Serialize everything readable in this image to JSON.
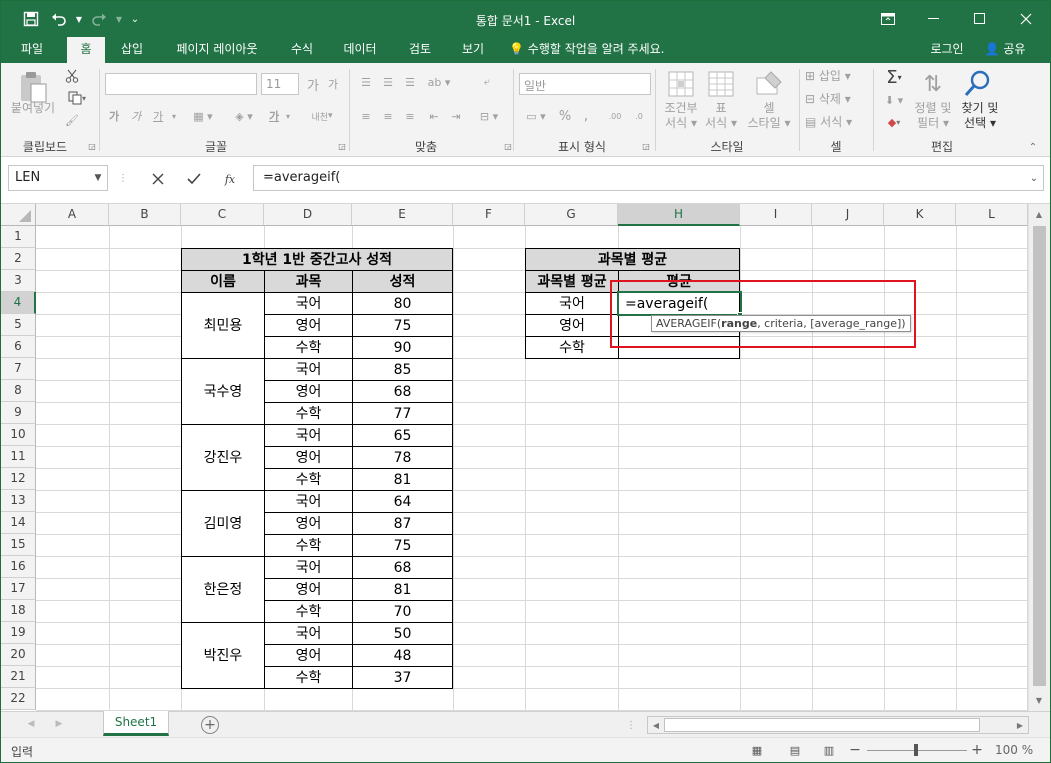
{
  "app": {
    "title": "통합 문서1 - Excel",
    "accent": "#217346"
  },
  "tabs": [
    "파일",
    "홈",
    "삽입",
    "페이지 레이아웃",
    "수식",
    "데이터",
    "검토",
    "보기"
  ],
  "active_tab": "홈",
  "tell_me": "수행할 작업을 알려 주세요.",
  "account": {
    "login": "로그인",
    "share": "공유"
  },
  "ribbon": {
    "clipboard": {
      "paste": "붙여넣기",
      "label": "클립보드"
    },
    "font": {
      "size": "11",
      "label": "글꼴",
      "bold": "가",
      "italic": "가",
      "underline": "가",
      "fontcolor": "가",
      "phonetic": "내천"
    },
    "alignment": {
      "label": "맞춤"
    },
    "number": {
      "format": "일반",
      "label": "표시 형식",
      "percent": "%"
    },
    "styles": {
      "cond_line1": "조건부",
      "cond_line2": "서식",
      "table_line1": "표",
      "table_line2": "서식",
      "cell_line1": "셀",
      "cell_line2": "스타일",
      "label": "스타일"
    },
    "cells": {
      "insert": "삽입",
      "delete": "삭제",
      "format": "서식",
      "label": "셀"
    },
    "editing": {
      "sort_line1": "정렬 및",
      "sort_line2": "필터",
      "find_line1": "찾기 및",
      "find_line2": "선택",
      "label": "편집"
    }
  },
  "formula_bar": {
    "name_box": "LEN",
    "fx": "fx",
    "formula": "=averageif("
  },
  "columns": [
    "A",
    "B",
    "C",
    "D",
    "E",
    "F",
    "G",
    "H",
    "I",
    "J",
    "K",
    "L"
  ],
  "rows": [
    "1",
    "2",
    "3",
    "4",
    "5",
    "6",
    "7",
    "8",
    "9",
    "10",
    "11",
    "12",
    "13",
    "14",
    "15",
    "16",
    "17",
    "18",
    "19",
    "20",
    "21",
    "22"
  ],
  "score_table": {
    "title": "1학년 1반 중간고사 성적",
    "headers": [
      "이름",
      "과목",
      "성적"
    ],
    "students": [
      {
        "name": "최민용",
        "subjects": [
          "국어",
          "영어",
          "수학"
        ],
        "scores": [
          "80",
          "75",
          "90"
        ]
      },
      {
        "name": "국수영",
        "subjects": [
          "국어",
          "영어",
          "수학"
        ],
        "scores": [
          "85",
          "68",
          "77"
        ]
      },
      {
        "name": "강진우",
        "subjects": [
          "국어",
          "영어",
          "수학"
        ],
        "scores": [
          "65",
          "78",
          "81"
        ]
      },
      {
        "name": "김미영",
        "subjects": [
          "국어",
          "영어",
          "수학"
        ],
        "scores": [
          "64",
          "87",
          "75"
        ]
      },
      {
        "name": "한은정",
        "subjects": [
          "국어",
          "영어",
          "수학"
        ],
        "scores": [
          "68",
          "81",
          "70"
        ]
      },
      {
        "name": "박진우",
        "subjects": [
          "국어",
          "영어",
          "수학"
        ],
        "scores": [
          "50",
          "48",
          "37"
        ]
      }
    ]
  },
  "avg_table": {
    "title": "과목별 평균",
    "headers": [
      "과목별 평균",
      "평균"
    ],
    "subjects": [
      "국어",
      "영어",
      "수학"
    ]
  },
  "active_cell": {
    "ref": "H4",
    "text": "=averageif("
  },
  "tooltip": {
    "fn": "AVERAGEIF(",
    "arg1": "range",
    "rest": ", criteria, [average_range])"
  },
  "sheet_tab": "Sheet1",
  "status": {
    "mode": "입력",
    "zoom": "100 %"
  }
}
